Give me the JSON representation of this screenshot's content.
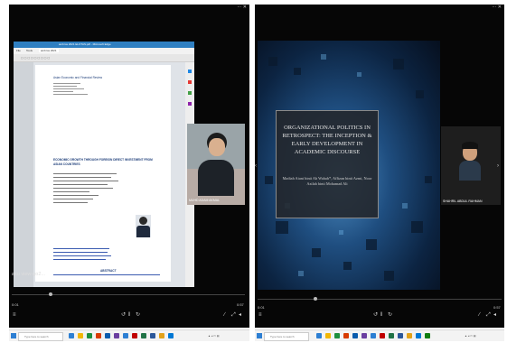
{
  "left_window": {
    "screen_share": {
      "titlebar_text": "ambros 2021 ELOTAS.pdf - Microsoft Edge",
      "tabs": [
        "File",
        "Tools",
        "ambros 2021"
      ],
      "document": {
        "journal_name": "Asian Economic and Financial Review",
        "paper_title": "ECONOMIC GROWTH THROUGH FOREIGN DIRECT INVESTMENT FROM ASIAN COUNTRIES",
        "abstract_heading": "ABSTRACT"
      }
    },
    "participant_name": "MUHD ADAM AKMAL",
    "caption_text": "aku view-go2..."
  },
  "right_window": {
    "slide": {
      "title": "ORGANIZATIONAL POLITICS IN RETROSPECT: THE INCEPTION & EARLY DEVELOPMENT IN ACADEMIC DISCOURSE",
      "authors": "Madiah Aiani binti Ab Wahab*, Affizan binti Azmi, Noor Azilah binti Mohamad Ali"
    },
    "participant_name": "SHAHRIL ABDUL RAHMAN",
    "time_elapsed": "0:01",
    "time_total": "0:57"
  },
  "left_time_elapsed": "0:01",
  "left_time_total": "0:57",
  "taskbar": {
    "search_placeholder": "Type here to search"
  }
}
